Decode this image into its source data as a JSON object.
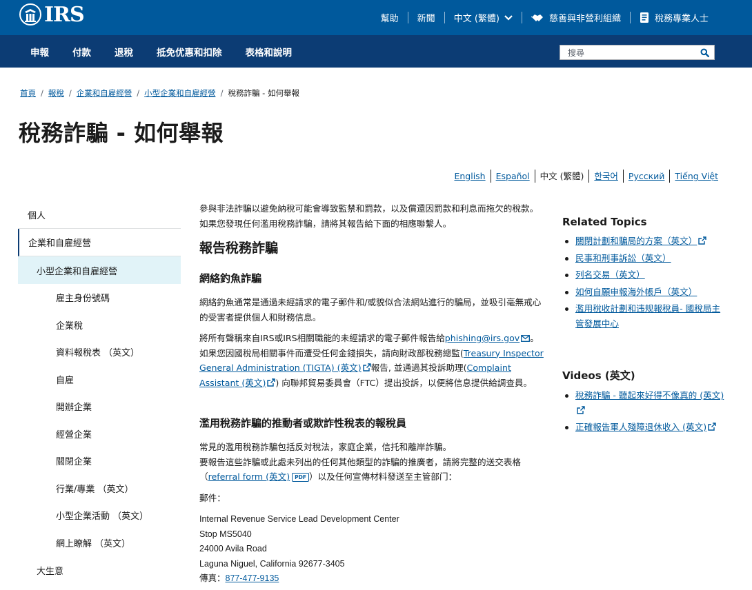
{
  "header": {
    "logo_text": "IRS",
    "utility": {
      "help": "幫助",
      "news": "新聞",
      "language": "中文 (繁體)",
      "charities": "慈善與非營利組織",
      "tax_pros": "稅務專業人士"
    },
    "nav": [
      "申報",
      "付款",
      "退稅",
      "抵免优惠和扣除",
      "表格和說明"
    ],
    "search_placeholder": "搜尋"
  },
  "breadcrumb": [
    "首頁",
    "報稅",
    "企業和自雇經營",
    "小型企業和自雇經營",
    "稅務詐騙 - 如何舉報"
  ],
  "page_title": "稅務詐騙 - 如何舉報",
  "languages": [
    "English",
    "Español",
    "中文 (繁體)",
    "한국어",
    "Русский",
    "Tiếng Việt"
  ],
  "sidebar": {
    "level1_top": "個人",
    "level1_selected": "企業和自雇經營",
    "level2_selected": "小型企業和自雇經營",
    "level3": [
      "雇主身份號碼",
      "企業稅",
      "資料報稅表 （英文）",
      "自雇",
      "開辦企業",
      "經營企業",
      "關閉企業",
      "行業/專業 （英文）",
      "小型企業活動 （英文）",
      "網上瞭解 （英文）"
    ],
    "level2_next": "大生意"
  },
  "main": {
    "intro": "參與非法詐騙以避免納稅可能會導致監禁和罰款，以及償還因罰款和利息而拖欠的稅款。 如果您發現任何濫用稅務詐騙，請將其報告給下面的相應聯繫人。",
    "h2": "報告稅務詐騙",
    "h3_phishing": "網絡釣魚詐騙",
    "p1": "網絡釣魚通常是通過未經請求的電子郵件和/或貌似合法網站進行的騙局，並吸引毫無戒心的受害者提供個人和財務信息。",
    "p2_a": "將所有聲稱來自IRS或IRS相關職能的未經請求的電子郵件報告給",
    "p2_email": "phishing@irs.gov",
    "p2_b": "。 如果您因國稅局相關事件而遭受任何金錢損失，請向財政部稅務總監(",
    "p2_tigta": "Treasury Inspector General Administration (TIGTA) (英文)",
    "p2_c": "報告, 並通過其投訴助理(",
    "p2_assistant": "Complaint Assistant (英文)",
    "p2_d": ") 向聯邦貿易委員會（FTC）提出投訴，以便將信息提供給調查員。",
    "h3_promoters": "濫用稅務詐騙的推動者或欺詐性稅表的報稅員",
    "p3_line1": "常見的濫用稅務詐騙包括反対稅法，家庭企業，信托和離岸詐騙。",
    "p3_line2_a": "要報告這些詐騙或此處未列出的任何其他類型的詐騙的推廣者，請將完整的送交表格（",
    "p3_referral": "referral form (英文)",
    "p3_pdf": "PDF",
    "p3_line2_b": "）以及任何宣傳材料發送至主管部门：",
    "mail_label": "郵件：",
    "address": [
      "Internal Revenue Service Lead Development Center",
      "Stop MS5040",
      "24000 Avila Road",
      "Laguna Niguel, California 92677-3405"
    ],
    "fax_label": "傳真：",
    "fax": "877-477-9135"
  },
  "related_topics": {
    "title": "Related Topics",
    "items": [
      "關閉計劃和騙局的方案（英文）",
      "民事和刑事訴訟（英文）",
      "列名交易（英文）",
      "如何自願申報海外帳戶（英文）",
      "濫用稅收計劃和违规報稅員- 國稅局主管發展中心"
    ]
  },
  "videos": {
    "title": "Videos (英文)",
    "items": [
      "稅務詐騙 - 聽起來好得不像真的 (英文)",
      "正確報告軍人殘障退休收入 (英文)"
    ]
  },
  "colors": {
    "header_blue": "#00599c",
    "nav_navy": "#0c3c74",
    "link": "#00599c",
    "sidebar_selected_bg": "#e1f3f8"
  },
  "icons": [
    "irs-eagle-logo-icon",
    "chevron-down-icon",
    "handshake-icon",
    "document-icon",
    "search-icon",
    "external-link-icon",
    "email-icon"
  ]
}
